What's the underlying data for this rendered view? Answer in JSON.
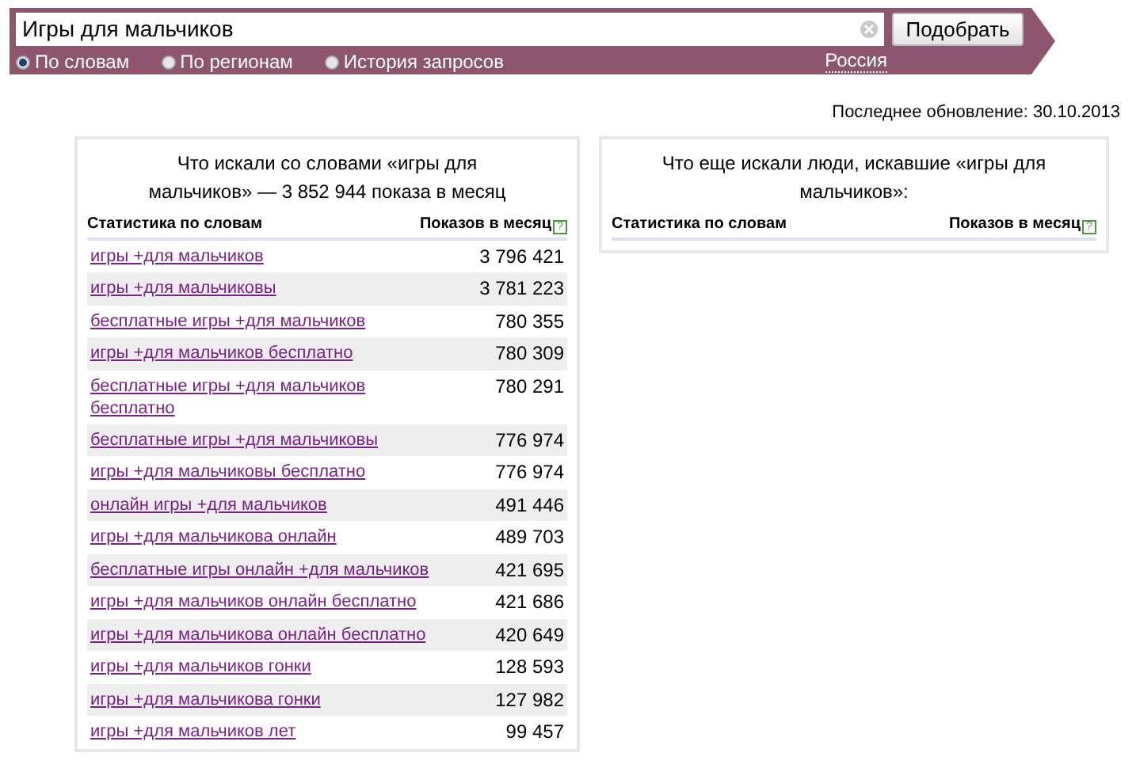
{
  "search": {
    "value": "Игры для мальчиков",
    "button": "Подобрать"
  },
  "modes": [
    {
      "label": "По словам",
      "selected": true
    },
    {
      "label": "По регионам",
      "selected": false
    },
    {
      "label": "История запросов",
      "selected": false
    }
  ],
  "region": "Россия",
  "last_update": "Последнее обновление: 30.10.2013",
  "left_panel": {
    "title": "Что искали со словами «игры для мальчиков» — 3 852 944 показа в месяц",
    "columns": [
      "Статистика по словам",
      "Показов в месяц"
    ],
    "help": "?",
    "rows": [
      {
        "phrase": "игры +для мальчиков",
        "count": "3 796 421"
      },
      {
        "phrase": "игры +для мальчиковы",
        "count": "3 781 223"
      },
      {
        "phrase": "бесплатные игры +для мальчиков",
        "count": "780 355"
      },
      {
        "phrase": "игры +для мальчиков бесплатно",
        "count": "780 309"
      },
      {
        "phrase": "бесплатные игры +для мальчиков бесплатно",
        "count": "780 291"
      },
      {
        "phrase": "бесплатные игры +для мальчиковы",
        "count": "776 974"
      },
      {
        "phrase": "игры +для мальчиковы бесплатно",
        "count": "776 974"
      },
      {
        "phrase": "онлайн игры +для мальчиков",
        "count": "491 446"
      },
      {
        "phrase": "игры +для мальчикова онлайн",
        "count": "489 703"
      },
      {
        "phrase": "бесплатные игры онлайн +для мальчиков",
        "count": "421 695"
      },
      {
        "phrase": "игры +для мальчиков онлайн бесплатно",
        "count": "421 686"
      },
      {
        "phrase": "игры +для мальчикова онлайн бесплатно",
        "count": "420 649"
      },
      {
        "phrase": "игры +для мальчиков гонки",
        "count": "128 593"
      },
      {
        "phrase": "игры +для мальчикова гонки",
        "count": "127 982"
      },
      {
        "phrase": "игры +для мальчиков лет",
        "count": "99 457"
      }
    ]
  },
  "right_panel": {
    "title": "Что еще искали люди, искавшие «игры для мальчиков»:",
    "columns": [
      "Статистика по словам",
      "Показов в месяц"
    ],
    "help": "?"
  }
}
